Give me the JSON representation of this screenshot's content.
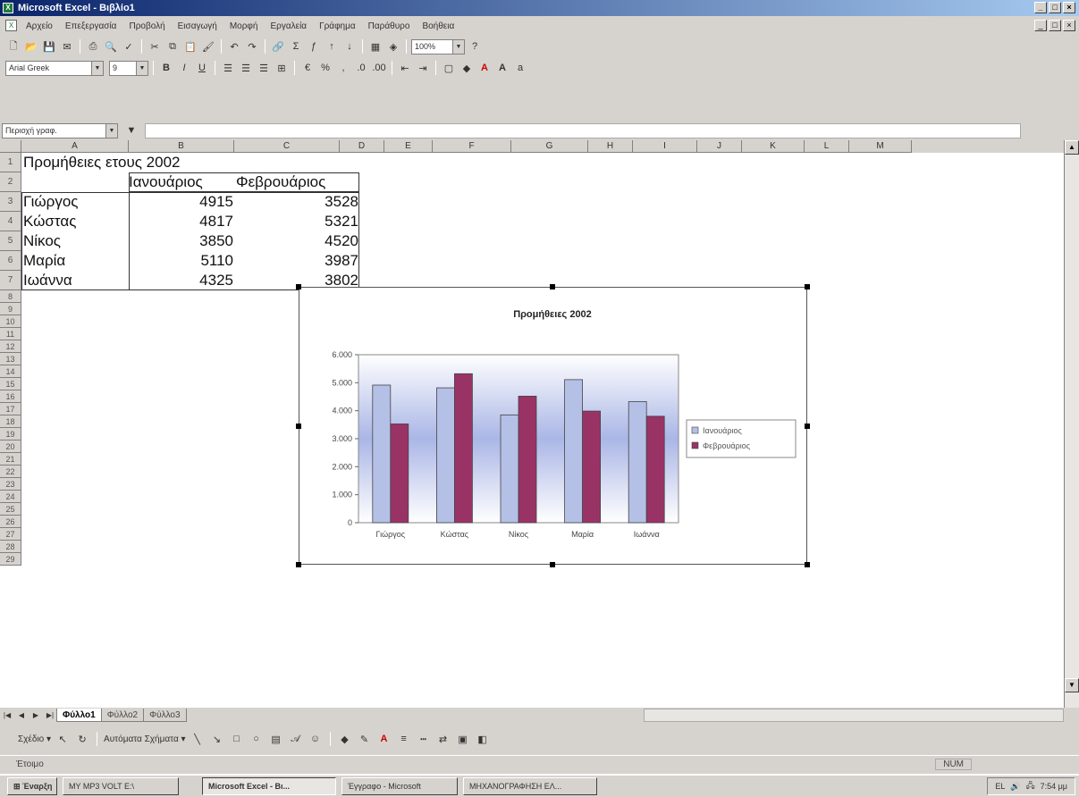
{
  "window": {
    "title": "Microsoft Excel - Βιβλίο1"
  },
  "menu": [
    "Αρχείο",
    "Επεξεργασία",
    "Προβολή",
    "Εισαγωγή",
    "Μορφή",
    "Εργαλεία",
    "Γράφημα",
    "Παράθυρο",
    "Βοήθεια"
  ],
  "toolbar": {
    "font_name": "Arial Greek",
    "font_size": "9",
    "zoom": "100%"
  },
  "name_box": {
    "value": "Περιοχή γραφ."
  },
  "columns": [
    "A",
    "B",
    "C",
    "D",
    "E",
    "F",
    "G",
    "H",
    "I",
    "J",
    "K",
    "L",
    "M"
  ],
  "rows": [
    "1",
    "2",
    "3",
    "4",
    "5",
    "6",
    "7",
    "8",
    "9",
    "10",
    "11",
    "12",
    "13",
    "14",
    "15",
    "16",
    "17",
    "18",
    "19",
    "20",
    "21",
    "22",
    "23",
    "24",
    "25",
    "26",
    "27",
    "28",
    "29"
  ],
  "sheet": {
    "title": "Προμήθειες ετους 2002",
    "header_jan": "Ιανουάριος",
    "header_feb": "Φεβρουάριος",
    "data": [
      {
        "name": "Γιώργος",
        "jan": "4915",
        "feb": "3528"
      },
      {
        "name": "Κώστας",
        "jan": "4817",
        "feb": "5321"
      },
      {
        "name": "Νίκος",
        "jan": "3850",
        "feb": "4520"
      },
      {
        "name": "Μαρία",
        "jan": "5110",
        "feb": "3987"
      },
      {
        "name": "Ιωάννα",
        "jan": "4325",
        "feb": "3802"
      }
    ]
  },
  "chart_data": {
    "type": "bar",
    "title": "Προμήθειες 2002",
    "categories": [
      "Γιώργος",
      "Κώστας",
      "Νίκος",
      "Μαρία",
      "Ιωάννα"
    ],
    "series": [
      {
        "name": "Ιανουάριος",
        "values": [
          4915,
          4817,
          3850,
          5110,
          4325
        ],
        "color": "#b4c0e6"
      },
      {
        "name": "Φεβρουάριος",
        "values": [
          3528,
          5321,
          4520,
          3987,
          3802
        ],
        "color": "#993366"
      }
    ],
    "ylim": [
      0,
      6000
    ],
    "yticks": [
      "0",
      "1.000",
      "2.000",
      "3.000",
      "4.000",
      "5.000",
      "6.000"
    ],
    "legend_position": "right",
    "grid": false
  },
  "sheet_tabs": [
    "Φύλλο1",
    "Φύλλο2",
    "Φύλλο3"
  ],
  "draw_toolbar": {
    "draw_label": "Σχέδιο ▾",
    "autoshapes_label": "Αυτόματα Σχήματα ▾"
  },
  "status": {
    "text": "Έτοιμο",
    "mode": "NUM"
  },
  "taskbar": {
    "start": "Έναρξη",
    "items": [
      "MY MP3 VOLT E:\\",
      "Microsoft Excel - Βι...",
      "Έγγραφο - Microsoft",
      "ΜΗΧΑΝΟΓΡΑΦΗΣΗ ΕΛ..."
    ],
    "clock": "7:54 μμ"
  }
}
